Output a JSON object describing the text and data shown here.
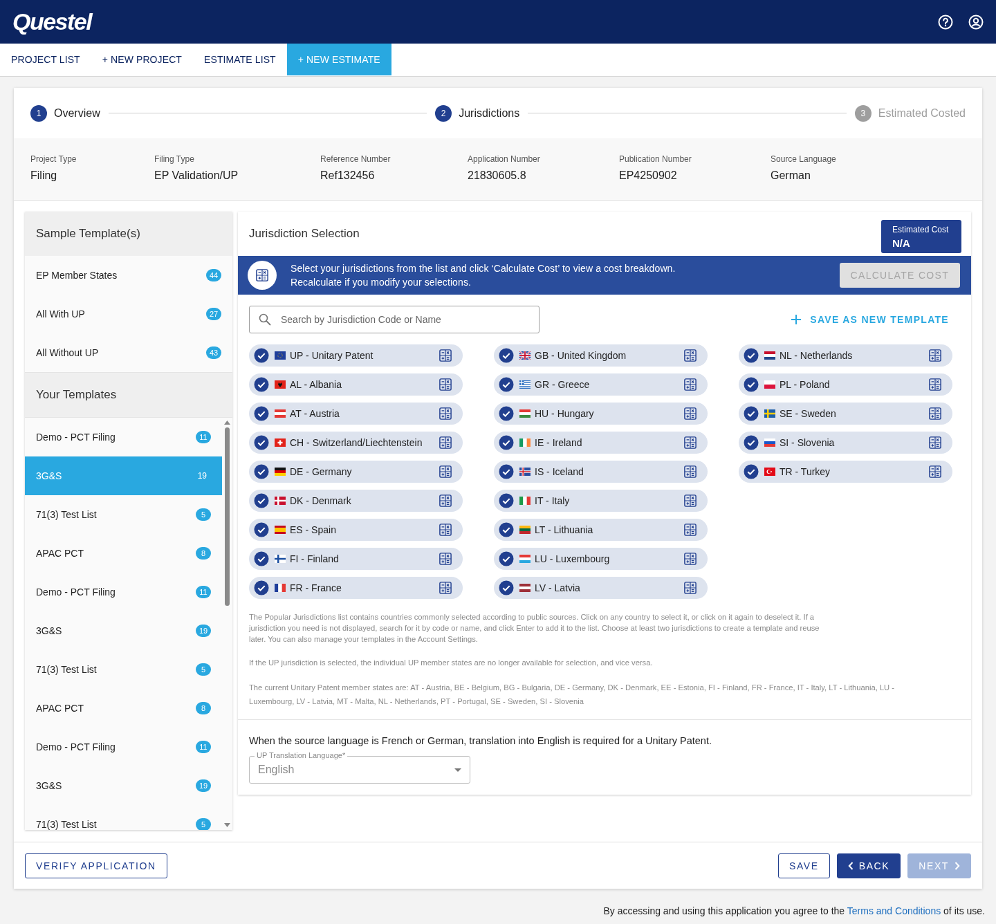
{
  "header": {
    "logo": "Questel"
  },
  "nav": {
    "tabs": [
      {
        "label": "PROJECT LIST",
        "selected": false
      },
      {
        "label": "+ NEW PROJECT",
        "selected": false
      },
      {
        "label": "ESTIMATE LIST",
        "selected": false
      },
      {
        "label": "+ NEW ESTIMATE",
        "selected": true
      }
    ]
  },
  "stepper": {
    "steps": [
      {
        "number": "1",
        "label": "Overview",
        "active": true
      },
      {
        "number": "2",
        "label": "Jurisdictions",
        "active": true
      },
      {
        "number": "3",
        "label": "Estimated Costed",
        "active": false
      }
    ]
  },
  "summary": [
    {
      "label": "Project Type",
      "value": "Filing"
    },
    {
      "label": "Filing Type",
      "value": "EP Validation/UP"
    },
    {
      "label": "Reference Number",
      "value": "Ref132456"
    },
    {
      "label": "Application Number",
      "value": "21830605.8"
    },
    {
      "label": "Publication Number",
      "value": "EP4250902"
    },
    {
      "label": "Source Language",
      "value": "German"
    }
  ],
  "sample_templates": {
    "title": "Sample Template(s)",
    "items": [
      {
        "name": "EP Member States",
        "count": "44",
        "selected": false
      },
      {
        "name": "All With UP",
        "count": "27",
        "selected": false
      },
      {
        "name": "All Without UP",
        "count": "43",
        "selected": false
      }
    ]
  },
  "your_templates": {
    "title": "Your Templates",
    "items": [
      {
        "name": "Demo - PCT Filing",
        "count": "11",
        "selected": false
      },
      {
        "name": "3G&S",
        "count": "19",
        "selected": true
      },
      {
        "name": "71(3) Test List",
        "count": "5",
        "selected": false
      },
      {
        "name": "APAC PCT",
        "count": "8",
        "selected": false
      },
      {
        "name": "Demo - PCT Filing",
        "count": "11",
        "selected": false
      },
      {
        "name": "3G&S",
        "count": "19",
        "selected": false
      },
      {
        "name": "71(3) Test List",
        "count": "5",
        "selected": false
      },
      {
        "name": "APAC PCT",
        "count": "8",
        "selected": false
      },
      {
        "name": "Demo - PCT Filing",
        "count": "11",
        "selected": false
      },
      {
        "name": "3G&S",
        "count": "19",
        "selected": false
      },
      {
        "name": "71(3) Test List",
        "count": "5",
        "selected": false
      }
    ]
  },
  "jurisdiction_panel": {
    "title": "Jurisdiction Selection",
    "estimated_cost": {
      "label": "Estimated Cost",
      "value": "N/A"
    },
    "banner": {
      "lines": [
        "Select your jurisdictions from the list and click ‘Calculate Cost’ to view a cost breakdown.",
        "Recalculate if you modify your selections."
      ]
    },
    "calculate_button": {
      "label": "CALCULATE COST",
      "disabled": true
    },
    "search": {
      "placeholder": "Search by Jurisdiction Code or Name"
    },
    "save_template": "SAVE AS NEW TEMPLATE",
    "columns": [
      {
        "items": [
          {
            "label": "UP - Unitary Patent",
            "selected": true
          },
          {
            "label": "AL - Albania",
            "selected": true
          },
          {
            "label": "AT - Austria",
            "selected": true
          },
          {
            "label": "CH - Switzerland/Liechtenstein",
            "selected": true
          },
          {
            "label": "DE - Germany",
            "selected": true
          },
          {
            "label": "DK - Denmark",
            "selected": true
          },
          {
            "label": "ES - Spain",
            "selected": true
          },
          {
            "label": "FI - Finland",
            "selected": true
          },
          {
            "label": "FR - France",
            "selected": true
          }
        ]
      },
      {
        "items": [
          {
            "label": "GB - United Kingdom",
            "selected": true
          },
          {
            "label": "GR - Greece",
            "selected": true
          },
          {
            "label": "HU - Hungary",
            "selected": true
          },
          {
            "label": "IE - Ireland",
            "selected": true
          },
          {
            "label": "IS - Iceland",
            "selected": true
          },
          {
            "label": "IT - Italy",
            "selected": true
          },
          {
            "label": "LT - Lithuania",
            "selected": true
          },
          {
            "label": "LU - Luxembourg",
            "selected": true
          },
          {
            "label": "LV - Latvia",
            "selected": true
          }
        ]
      },
      {
        "items": [
          {
            "label": "NL - Netherlands",
            "selected": true
          },
          {
            "label": "PL - Poland",
            "selected": true
          },
          {
            "label": "SE - Sweden",
            "selected": true
          },
          {
            "label": "SI - Slovenia",
            "selected": true
          },
          {
            "label": "TR - Turkey",
            "selected": true
          }
        ]
      }
    ],
    "notes": [
      "The Popular Jurisdictions list contains countries commonly selected according to public sources. Click on any country to select it, or click on it again to deselect it. If a jurisdiction you need is not displayed, search for it by code or name, and click Enter to add it to the list. Choose at least two jurisdictions to create a template and reuse later. You can also manage your templates in the Account Settings.",
      "If the UP jurisdiction is selected, the individual UP member states are no longer available for selection, and vice versa.",
      "The current Unitary Patent member states are: AT - Austria, BE - Belgium, BG - Bulgaria, DE - Germany, DK - Denmark, EE - Estonia, FI - Finland, FR - France, IT - Italy, LT - Lithuania, LU - Luxembourg, LV - Latvia, MT - Malta, NL - Netherlands, PT - Portugal, SE - Sweden, SI - Slovenia"
    ]
  },
  "translation": {
    "text": "When the source language is French or German, translation into English is required for a Unitary Patent.",
    "field": {
      "label": "UP Translation Language*",
      "value": "English",
      "disabled": true
    }
  },
  "actions": {
    "verify": "VERIFY APPLICATION",
    "buttons": [
      {
        "kind": "save",
        "label": "SAVE",
        "disabled": false
      },
      {
        "kind": "back",
        "label": "BACK",
        "disabled": false
      },
      {
        "kind": "next",
        "label": "NEXT",
        "disabled": true
      }
    ]
  },
  "footer": {
    "before": "By accessing and using this application you agree to the ",
    "link": "Terms and Conditions",
    "after": " of its use."
  }
}
